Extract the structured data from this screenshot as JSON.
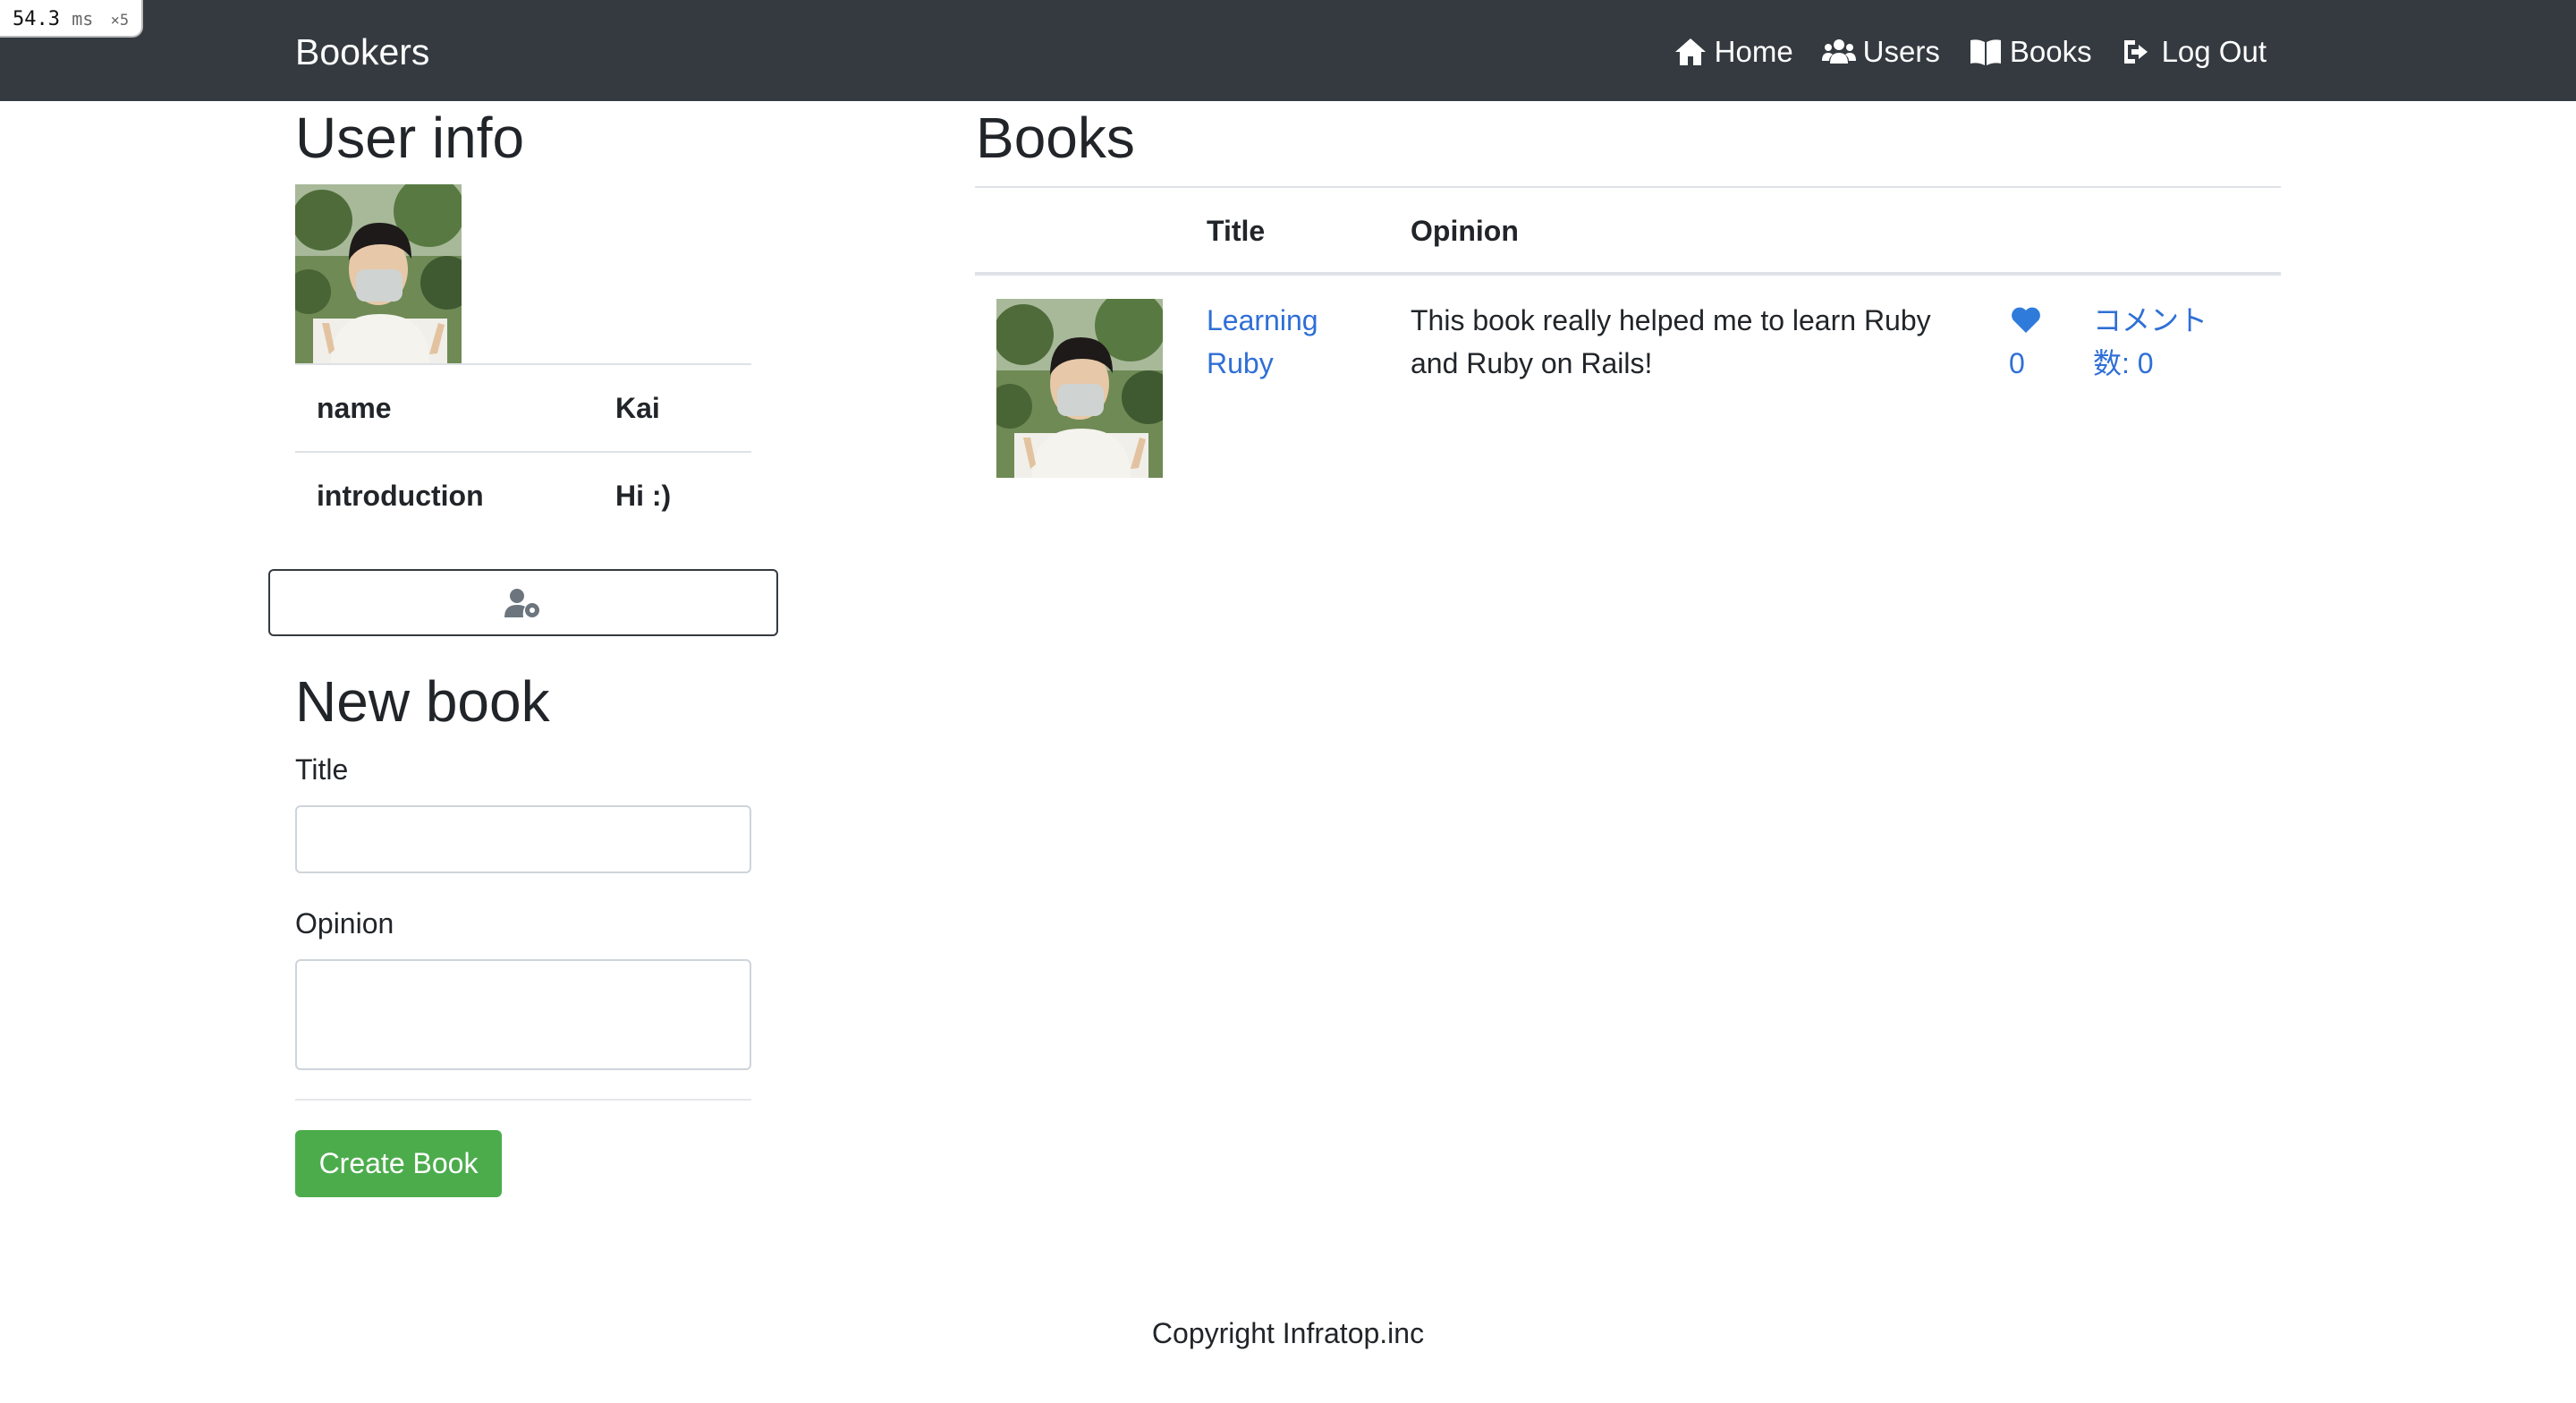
{
  "perf": {
    "value": "54.3",
    "unit": "ms",
    "multiplier": "×5"
  },
  "navbar": {
    "brand": "Bookers",
    "items": [
      {
        "label": "Home",
        "icon": "home-icon"
      },
      {
        "label": "Users",
        "icon": "users-icon"
      },
      {
        "label": "Books",
        "icon": "book-open-icon"
      },
      {
        "label": "Log Out",
        "icon": "sign-out-icon"
      }
    ]
  },
  "user_info": {
    "title": "User info",
    "rows": [
      {
        "key": "name",
        "value": "Kai"
      },
      {
        "key": "introduction",
        "value": "Hi :)"
      }
    ],
    "edit_icon": "user-cog-icon"
  },
  "new_book": {
    "title": "New book",
    "title_label": "Title",
    "title_value": "",
    "opinion_label": "Opinion",
    "opinion_value": "",
    "submit_label": "Create Book"
  },
  "books": {
    "title": "Books",
    "headers": {
      "col_image": "",
      "col_title": "Title",
      "col_opinion": "Opinion"
    },
    "rows": [
      {
        "title": "Learning Ruby",
        "opinion": "This book really helped me to learn Ruby and Ruby on Rails!",
        "favorites": "0",
        "comments": "コメント数: 0"
      }
    ]
  },
  "footer": {
    "text": "Copyright Infratop.inc"
  },
  "colors": {
    "navbar": "#343a40",
    "link": "#2f6fd6",
    "success": "#4cac4c"
  }
}
